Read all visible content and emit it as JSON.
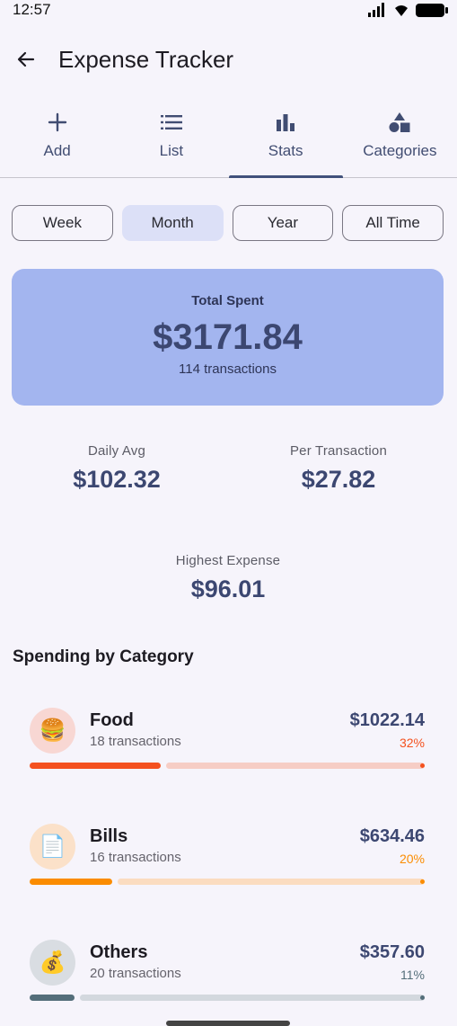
{
  "status_bar": {
    "time": "12:57"
  },
  "app_bar": {
    "title": "Expense Tracker"
  },
  "tabs": [
    {
      "label": "Add",
      "icon": "plus-icon"
    },
    {
      "label": "List",
      "icon": "list-icon"
    },
    {
      "label": "Stats",
      "icon": "bar-chart-icon",
      "active": true
    },
    {
      "label": "Categories",
      "icon": "shapes-icon"
    }
  ],
  "filters": [
    {
      "label": "Week"
    },
    {
      "label": "Month",
      "selected": true
    },
    {
      "label": "Year"
    },
    {
      "label": "All Time"
    }
  ],
  "summary": {
    "total_label": "Total Spent",
    "total_amount": "$3171.84",
    "transactions": "114 transactions",
    "daily_avg_label": "Daily Avg",
    "daily_avg_value": "$102.32",
    "per_tx_label": "Per Transaction",
    "per_tx_value": "$27.82",
    "highest_label": "Highest Expense",
    "highest_value": "$96.01"
  },
  "section": {
    "title": "Spending by Category"
  },
  "categories": [
    {
      "name": "Food",
      "count": "18 transactions",
      "amount": "$1022.14",
      "percent": "32%",
      "fraction": 0.32,
      "icon": "burger-icon",
      "emoji": "🍔",
      "color": "#f4511e",
      "track": "#f6cdc5",
      "bg": "#f8d7d3"
    },
    {
      "name": "Bills",
      "count": "16 transactions",
      "amount": "$634.46",
      "percent": "20%",
      "fraction": 0.2,
      "icon": "document-icon",
      "emoji": "📄",
      "color": "#fb8c00",
      "track": "#fbdcc0",
      "bg": "#fbe1c9"
    },
    {
      "name": "Others",
      "count": "20 transactions",
      "amount": "$357.60",
      "percent": "11%",
      "fraction": 0.11,
      "icon": "money-bag-icon",
      "emoji": "💰",
      "color": "#546e7a",
      "track": "#d3d8de",
      "bg": "#d9dde2"
    }
  ]
}
